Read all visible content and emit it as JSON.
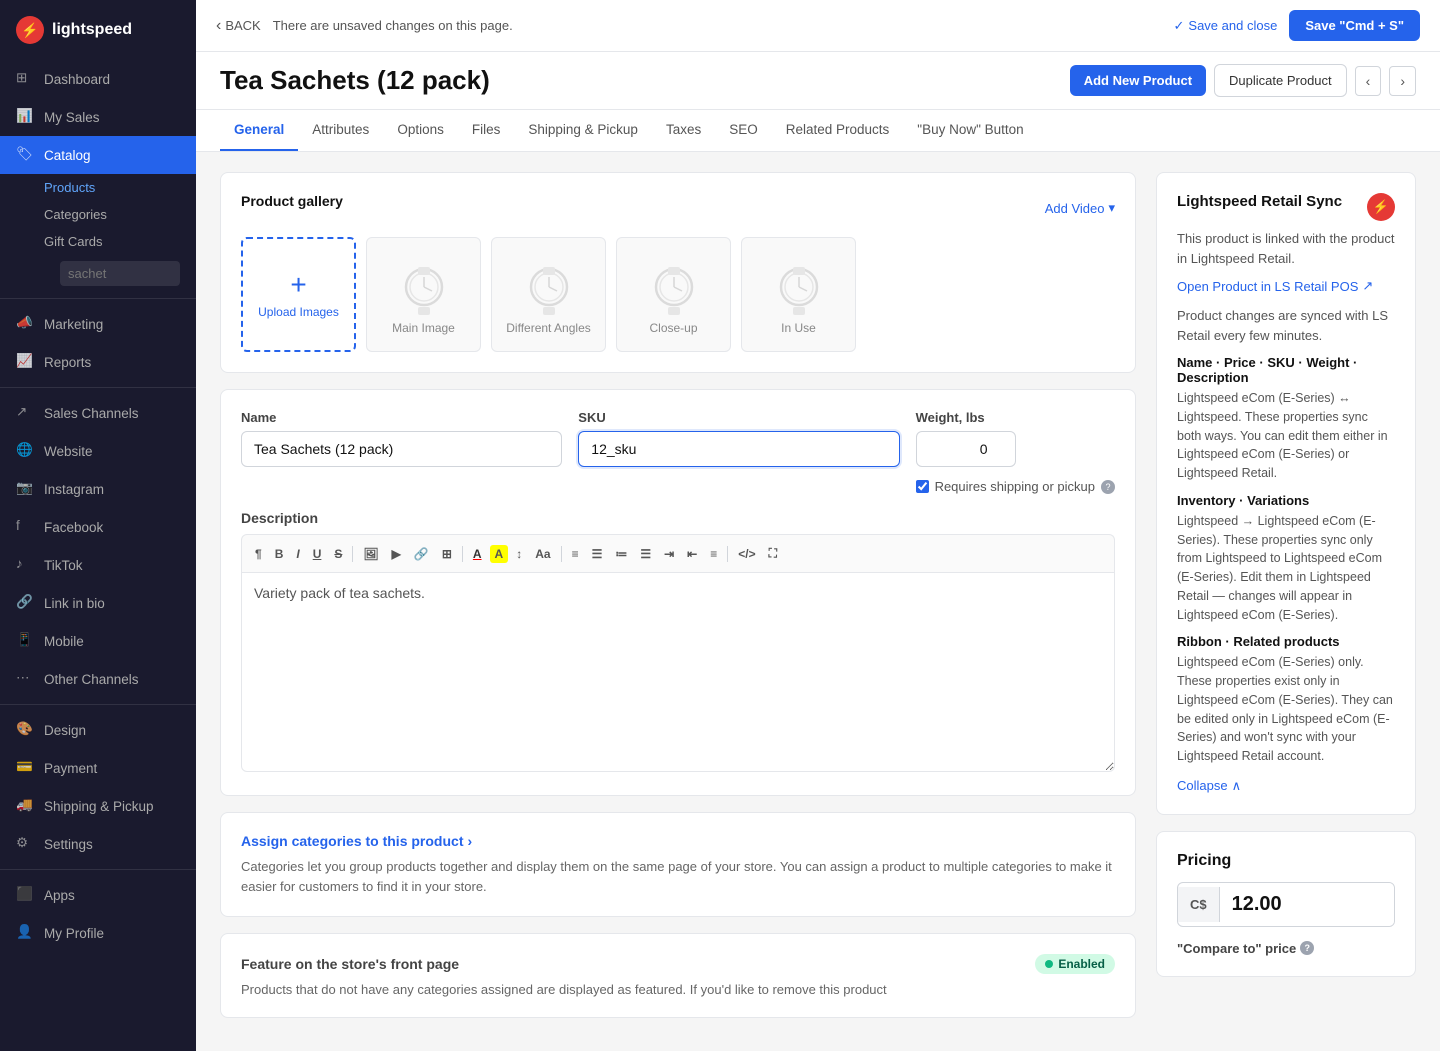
{
  "sidebar": {
    "logo_text": "lightspeed",
    "items": [
      {
        "id": "dashboard",
        "label": "Dashboard",
        "icon": "grid"
      },
      {
        "id": "my-sales",
        "label": "My Sales",
        "icon": "bar-chart"
      },
      {
        "id": "catalog",
        "label": "Catalog",
        "icon": "tag",
        "active": true
      },
      {
        "id": "marketing",
        "label": "Marketing",
        "icon": "megaphone"
      },
      {
        "id": "reports",
        "label": "Reports",
        "icon": "chart"
      },
      {
        "id": "sales-channels",
        "label": "Sales Channels",
        "icon": "share"
      },
      {
        "id": "website",
        "label": "Website",
        "icon": "globe"
      },
      {
        "id": "instagram",
        "label": "Instagram",
        "icon": "instagram"
      },
      {
        "id": "facebook",
        "label": "Facebook",
        "icon": "facebook"
      },
      {
        "id": "tiktok",
        "label": "TikTok",
        "icon": "tiktok"
      },
      {
        "id": "link-in-bio",
        "label": "Link in bio",
        "icon": "link"
      },
      {
        "id": "mobile",
        "label": "Mobile",
        "icon": "mobile"
      },
      {
        "id": "other-channels",
        "label": "Other Channels",
        "icon": "more-horiz"
      },
      {
        "id": "design",
        "label": "Design",
        "icon": "palette"
      },
      {
        "id": "payment",
        "label": "Payment",
        "icon": "credit-card"
      },
      {
        "id": "shipping",
        "label": "Shipping & Pickup",
        "icon": "truck"
      },
      {
        "id": "settings",
        "label": "Settings",
        "icon": "gear"
      },
      {
        "id": "apps",
        "label": "Apps",
        "icon": "apps"
      },
      {
        "id": "my-profile",
        "label": "My Profile",
        "icon": "user"
      }
    ],
    "catalog_sub": [
      {
        "id": "products",
        "label": "Products",
        "active": true
      },
      {
        "id": "categories",
        "label": "Categories"
      },
      {
        "id": "gift-cards",
        "label": "Gift Cards"
      }
    ],
    "search_placeholder": "sachet"
  },
  "topbar": {
    "back_label": "BACK",
    "unsaved_msg": "There are unsaved changes on this page.",
    "save_close_label": "Save and close",
    "save_primary_label": "Save \"Cmd + S\""
  },
  "page": {
    "title": "Tea Sachets (12 pack)",
    "add_new_label": "Add New Product",
    "duplicate_label": "Duplicate Product"
  },
  "tabs": [
    {
      "id": "general",
      "label": "General",
      "active": true
    },
    {
      "id": "attributes",
      "label": "Attributes"
    },
    {
      "id": "options",
      "label": "Options"
    },
    {
      "id": "files",
      "label": "Files"
    },
    {
      "id": "shipping",
      "label": "Shipping & Pickup"
    },
    {
      "id": "taxes",
      "label": "Taxes"
    },
    {
      "id": "seo",
      "label": "SEO"
    },
    {
      "id": "related",
      "label": "Related Products"
    },
    {
      "id": "buy-now",
      "label": "\"Buy Now\" Button"
    }
  ],
  "gallery": {
    "title": "Product gallery",
    "add_video_label": "Add Video",
    "upload_label": "Upload Images",
    "images": [
      {
        "id": "main",
        "label": "Main Image"
      },
      {
        "id": "angles",
        "label": "Different Angles"
      },
      {
        "id": "closeup",
        "label": "Close-up"
      },
      {
        "id": "inuse",
        "label": "In Use"
      }
    ]
  },
  "form": {
    "name_label": "Name",
    "name_value": "Tea Sachets (12 pack)",
    "sku_label": "SKU",
    "sku_value": "12_sku",
    "weight_label": "Weight, lbs",
    "weight_value": "0",
    "requires_shipping_label": "Requires shipping or pickup",
    "description_label": "Description",
    "description_value": "Variety pack of tea sachets."
  },
  "categories": {
    "assign_label": "Assign categories to this product",
    "assign_arrow": "›",
    "desc": "Categories let you group products together and display them on the same page of your store. You can assign a product to multiple categories to make it easier for customers to find it in your store."
  },
  "feature": {
    "label": "Feature on the store's front page",
    "enabled_label": "Enabled",
    "desc": "Products that do not have any categories assigned are displayed as featured. If you'd like to remove this product"
  },
  "sync_panel": {
    "title": "Lightspeed Retail Sync",
    "desc": "This product is linked with the product in Lightspeed Retail.",
    "open_link": "Open Product in LS Retail POS",
    "sync_desc": "Product changes are synced with LS Retail every few minutes.",
    "sections": [
      {
        "title": "Name · Price · SKU · Weight · Description",
        "desc": "Lightspeed eCom (E-Series) ↔ Lightspeed. These properties sync both ways. You can edit them either in Lightspeed eCom (E-Series) or Lightspeed Retail."
      },
      {
        "title": "Inventory · Variations",
        "desc": "Lightspeed → Lightspeed eCom (E-Series). These properties sync only from Lightspeed to Lightspeed eCom (E-Series). Edit them in Lightspeed Retail — changes will appear in Lightspeed eCom (E-Series)."
      },
      {
        "title": "Ribbon · Related products",
        "desc": "Lightspeed eCom (E-Series) only. These properties exist only in Lightspeed eCom (E-Series). They can be edited only in Lightspeed eCom (E-Series) and won't sync with your Lightspeed Retail account."
      }
    ],
    "collapse_label": "Collapse"
  },
  "pricing": {
    "title": "Pricing",
    "currency": "C$",
    "price": "12.00",
    "compare_label": "\"Compare to\" price"
  }
}
